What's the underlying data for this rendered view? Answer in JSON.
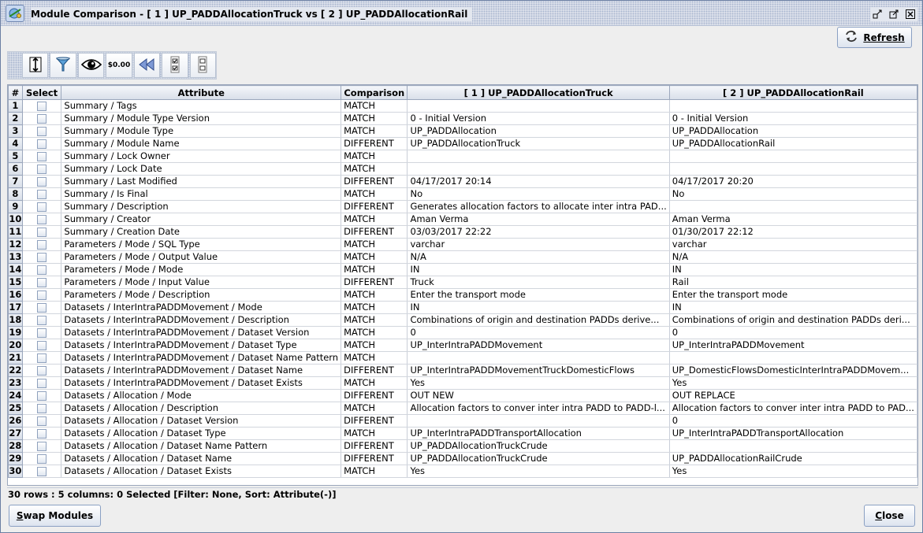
{
  "window": {
    "title": "Module Comparison  -  [ 1 ] UP_PADDAllocationTruck   vs  [ 2 ] UP_PADDAllocationRail"
  },
  "header": {
    "refresh_label": "Refresh"
  },
  "toolbar": {
    "buttons": [
      {
        "icon": "sort-icon"
      },
      {
        "icon": "filter-icon"
      },
      {
        "icon": "view-icon"
      },
      {
        "icon": "format-icon",
        "text": "$0.00"
      },
      {
        "icon": "reset-icon"
      },
      {
        "icon": "select-all-icon"
      },
      {
        "icon": "clear-selection-icon"
      }
    ]
  },
  "table": {
    "columns": [
      "#",
      "Select",
      "Attribute",
      "Comparison",
      "[ 1 ] UP_PADDAllocationTruck",
      "[ 2 ] UP_PADDAllocationRail"
    ],
    "rows": [
      {
        "num": "1",
        "attribute": "Summary / Tags",
        "comparison": "MATCH",
        "m1": "",
        "m2": ""
      },
      {
        "num": "2",
        "attribute": "Summary / Module Type Version",
        "comparison": "MATCH",
        "m1": "0 - Initial Version",
        "m2": "0 - Initial Version"
      },
      {
        "num": "3",
        "attribute": "Summary / Module Type",
        "comparison": "MATCH",
        "m1": "UP_PADDAllocation",
        "m2": "UP_PADDAllocation"
      },
      {
        "num": "4",
        "attribute": "Summary / Module Name",
        "comparison": "DIFFERENT",
        "m1": "UP_PADDAllocationTruck",
        "m2": "UP_PADDAllocationRail"
      },
      {
        "num": "5",
        "attribute": "Summary / Lock Owner",
        "comparison": "MATCH",
        "m1": "",
        "m2": ""
      },
      {
        "num": "6",
        "attribute": "Summary / Lock Date",
        "comparison": "MATCH",
        "m1": "",
        "m2": ""
      },
      {
        "num": "7",
        "attribute": "Summary / Last Modified",
        "comparison": "DIFFERENT",
        "m1": "04/17/2017 20:14",
        "m2": "04/17/2017 20:20"
      },
      {
        "num": "8",
        "attribute": "Summary / Is Final",
        "comparison": "MATCH",
        "m1": "No",
        "m2": "No"
      },
      {
        "num": "9",
        "attribute": "Summary / Description",
        "comparison": "DIFFERENT",
        "m1": "Generates allocation factors to allocate inter intra PAD...",
        "m2": ""
      },
      {
        "num": "10",
        "attribute": "Summary / Creator",
        "comparison": "MATCH",
        "m1": "Aman Verma",
        "m2": "Aman Verma"
      },
      {
        "num": "11",
        "attribute": "Summary / Creation Date",
        "comparison": "DIFFERENT",
        "m1": "03/03/2017 22:22",
        "m2": "01/30/2017 22:12"
      },
      {
        "num": "12",
        "attribute": "Parameters / Mode / SQL Type",
        "comparison": "MATCH",
        "m1": "varchar",
        "m2": "varchar"
      },
      {
        "num": "13",
        "attribute": "Parameters / Mode / Output Value",
        "comparison": "MATCH",
        "m1": "N/A",
        "m2": "N/A"
      },
      {
        "num": "14",
        "attribute": "Parameters / Mode / Mode",
        "comparison": "MATCH",
        "m1": "IN",
        "m2": "IN"
      },
      {
        "num": "15",
        "attribute": "Parameters / Mode / Input Value",
        "comparison": "DIFFERENT",
        "m1": "Truck",
        "m2": "Rail"
      },
      {
        "num": "16",
        "attribute": "Parameters / Mode / Description",
        "comparison": "MATCH",
        "m1": "Enter the transport mode",
        "m2": "Enter the transport mode"
      },
      {
        "num": "17",
        "attribute": "Datasets / InterIntraPADDMovement / Mode",
        "comparison": "MATCH",
        "m1": "IN",
        "m2": "IN"
      },
      {
        "num": "18",
        "attribute": "Datasets / InterIntraPADDMovement / Description",
        "comparison": "MATCH",
        "m1": "Combinations of origin and destination PADDs derive...",
        "m2": "Combinations of origin and destination PADDs deri..."
      },
      {
        "num": "19",
        "attribute": "Datasets / InterIntraPADDMovement / Dataset Version",
        "comparison": "MATCH",
        "m1": "0",
        "m2": "0"
      },
      {
        "num": "20",
        "attribute": "Datasets / InterIntraPADDMovement / Dataset Type",
        "comparison": "MATCH",
        "m1": "UP_InterIntraPADDMovement",
        "m2": "UP_InterIntraPADDMovement"
      },
      {
        "num": "21",
        "attribute": "Datasets / InterIntraPADDMovement / Dataset Name Pattern",
        "comparison": "MATCH",
        "m1": "",
        "m2": ""
      },
      {
        "num": "22",
        "attribute": "Datasets / InterIntraPADDMovement / Dataset Name",
        "comparison": "DIFFERENT",
        "m1": "UP_InterIntraPADDMovementTruckDomesticFlows",
        "m2": "UP_DomesticFlowsDomesticInterIntraPADDMovem..."
      },
      {
        "num": "23",
        "attribute": "Datasets / InterIntraPADDMovement / Dataset Exists",
        "comparison": "MATCH",
        "m1": "Yes",
        "m2": "Yes"
      },
      {
        "num": "24",
        "attribute": "Datasets / Allocation / Mode",
        "comparison": "DIFFERENT",
        "m1": "OUT NEW",
        "m2": "OUT REPLACE"
      },
      {
        "num": "25",
        "attribute": "Datasets / Allocation / Description",
        "comparison": "MATCH",
        "m1": "Allocation factors to conver inter intra PADD to PADD-l...",
        "m2": "Allocation factors to conver inter intra PADD to PAD..."
      },
      {
        "num": "26",
        "attribute": "Datasets / Allocation / Dataset Version",
        "comparison": "DIFFERENT",
        "m1": "",
        "m2": "0"
      },
      {
        "num": "27",
        "attribute": "Datasets / Allocation / Dataset Type",
        "comparison": "MATCH",
        "m1": "UP_InterIntraPADDTransportAllocation",
        "m2": "UP_InterIntraPADDTransportAllocation"
      },
      {
        "num": "28",
        "attribute": "Datasets / Allocation / Dataset Name Pattern",
        "comparison": "DIFFERENT",
        "m1": "UP_PADDAllocationTruckCrude",
        "m2": ""
      },
      {
        "num": "29",
        "attribute": "Datasets / Allocation / Dataset Name",
        "comparison": "DIFFERENT",
        "m1": "UP_PADDAllocationTruckCrude",
        "m2": "UP_PADDAllocationRailCrude"
      },
      {
        "num": "30",
        "attribute": "Datasets / Allocation / Dataset Exists",
        "comparison": "MATCH",
        "m1": "Yes",
        "m2": "Yes"
      }
    ]
  },
  "status": {
    "text": "30 rows : 5 columns: 0 Selected [Filter: None, Sort: Attribute(-)]"
  },
  "footer": {
    "swap_label_first": "S",
    "swap_label_rest": "wap Modules",
    "close_label_first": "C",
    "close_label_rest": "lose"
  }
}
